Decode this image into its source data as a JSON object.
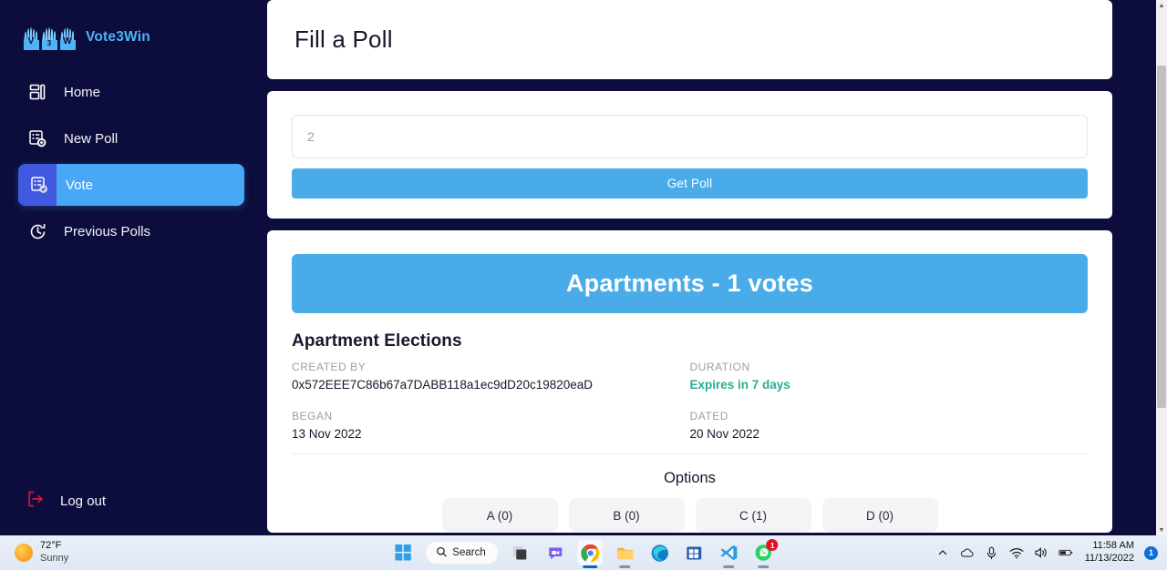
{
  "sidebar": {
    "brand": {
      "name": "Vote3Win",
      "logo_letters": [
        "V",
        "3",
        "W"
      ]
    },
    "items": [
      {
        "label": "Home",
        "icon": "dashboard-icon",
        "active": false
      },
      {
        "label": "New Poll",
        "icon": "form-plus-icon",
        "active": false
      },
      {
        "label": "Vote",
        "icon": "form-check-icon",
        "active": true
      },
      {
        "label": "Previous Polls",
        "icon": "clock-history-icon",
        "active": false
      }
    ],
    "logout": {
      "label": "Log out",
      "icon": "logout-icon"
    }
  },
  "main": {
    "page_title": "Fill a Poll",
    "form": {
      "input_value": "",
      "input_placeholder": "2",
      "submit_label": "Get Poll"
    },
    "poll": {
      "banner": "Apartments - 1 votes",
      "name": "Apartment Elections",
      "meta": [
        {
          "label": "CREATED BY",
          "value": "0x572EEE7C86b67a7DABB118a1ec9dD20c19820eaD",
          "accent": false
        },
        {
          "label": "DURATION",
          "value": "Expires in 7 days",
          "accent": true
        },
        {
          "label": "BEGAN",
          "value": "13 Nov 2022",
          "accent": false
        },
        {
          "label": "DATED",
          "value": "20 Nov 2022",
          "accent": false
        }
      ],
      "options_title": "Options",
      "options": [
        {
          "label": "A (0)"
        },
        {
          "label": "B (0)"
        },
        {
          "label": "C (1)"
        },
        {
          "label": "D (0)"
        }
      ]
    }
  },
  "colors": {
    "sidebar_bg": "#0d0d3d",
    "accent_blue": "#49ace9",
    "active_nav": "#4158e0",
    "brand_blue": "#4db4f7",
    "success_green": "#27ae8e",
    "logout_red": "#d6153c"
  },
  "scrollbar": {
    "up_arrow": "▲",
    "down_arrow": "▼"
  },
  "taskbar": {
    "weather": {
      "temp": "72°F",
      "condition": "Sunny",
      "icon": "sun-icon"
    },
    "search": {
      "label": "Search",
      "icon": "search-icon"
    },
    "apps": [
      {
        "name": "start-icon",
        "running": false,
        "active": false
      },
      {
        "name": "task-view-icon",
        "running": false,
        "active": false
      },
      {
        "name": "chat-icon",
        "running": false,
        "active": false
      },
      {
        "name": "chrome-icon",
        "running": true,
        "active": true
      },
      {
        "name": "file-explorer-icon",
        "running": true,
        "active": false
      },
      {
        "name": "edge-icon",
        "running": false,
        "active": false
      },
      {
        "name": "microsoft-store-icon",
        "running": false,
        "active": false
      },
      {
        "name": "vscode-icon",
        "running": true,
        "active": false
      },
      {
        "name": "whatsapp-icon",
        "running": true,
        "active": false,
        "badge": "1"
      }
    ],
    "tray": {
      "icons": [
        "chevron-up-icon",
        "onedrive-icon",
        "microphone-icon",
        "wifi-icon",
        "speaker-icon",
        "battery-icon"
      ],
      "time": "11:58 AM",
      "date": "11/13/2022",
      "notification_count": "1"
    }
  }
}
